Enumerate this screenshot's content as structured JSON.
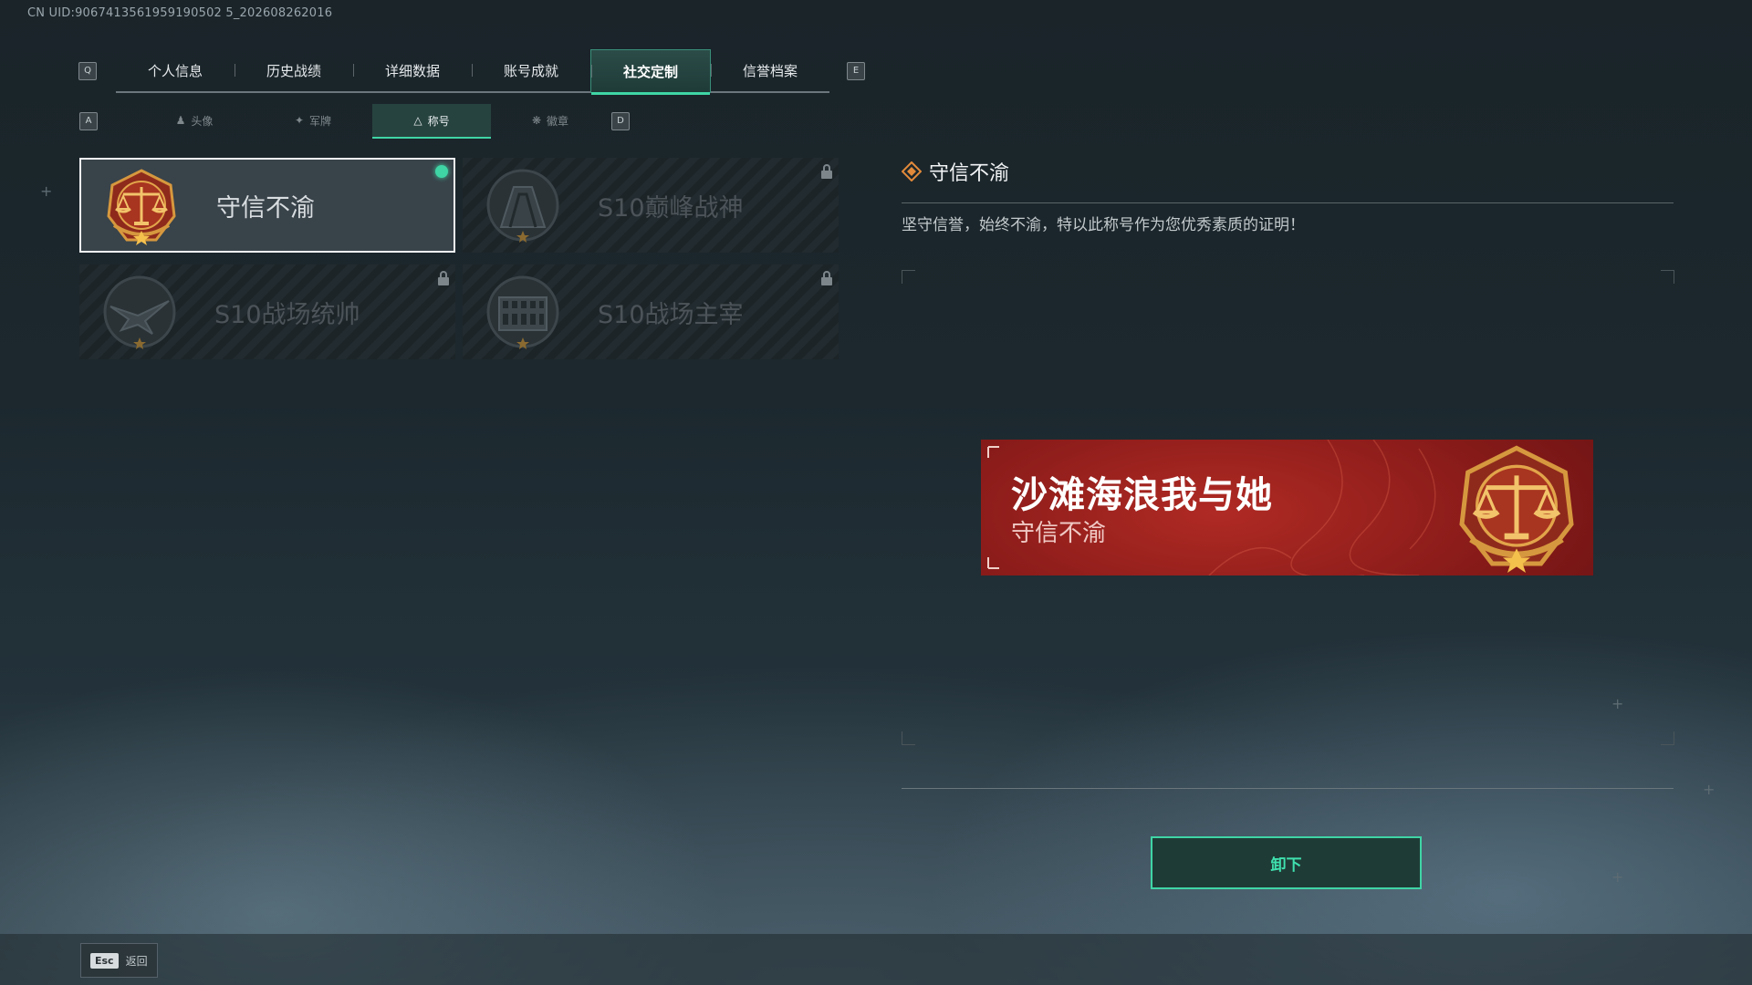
{
  "uid": "CN UID:9067413561959190502 5_202608262016",
  "header": {
    "left_key": "Q",
    "right_key": "E",
    "tabs": [
      "个人信息",
      "历史战绩",
      "详细数据",
      "账号成就",
      "社交定制",
      "信誉档案"
    ],
    "active_tab": 4
  },
  "subnav": {
    "left_key": "A",
    "right_key": "D",
    "tabs": [
      {
        "label": "头像",
        "icon": "person-icon"
      },
      {
        "label": "军牌",
        "icon": "dogtag-icon"
      },
      {
        "label": "称号",
        "icon": "triangle-icon"
      },
      {
        "label": "徽章",
        "icon": "wings-icon"
      }
    ],
    "active_tab": 2
  },
  "titles": [
    {
      "name": "守信不渝",
      "locked": false,
      "equipped": true,
      "selected": true,
      "emblem": "scales-icon"
    },
    {
      "name": "S10巅峰战神",
      "locked": true,
      "equipped": false,
      "selected": false,
      "emblem": "peak-icon"
    },
    {
      "name": "S10战场统帅",
      "locked": true,
      "equipped": false,
      "selected": false,
      "emblem": "eagle-icon"
    },
    {
      "name": "S10战场主宰",
      "locked": true,
      "equipped": false,
      "selected": false,
      "emblem": "colosseum-icon"
    }
  ],
  "detail": {
    "title": "守信不渝",
    "description": "坚守信誉，始终不渝，特以此称号作为您优秀素质的证明！"
  },
  "preview": {
    "player_name": "沙滩海浪我与她",
    "title": "守信不渝"
  },
  "actions": {
    "unequip": "卸下",
    "back_key": "Esc",
    "back": "返回"
  },
  "colors": {
    "accent": "#3fd5a5",
    "preview_bg": "#a32420",
    "emblem_gold": "#d6983e"
  }
}
